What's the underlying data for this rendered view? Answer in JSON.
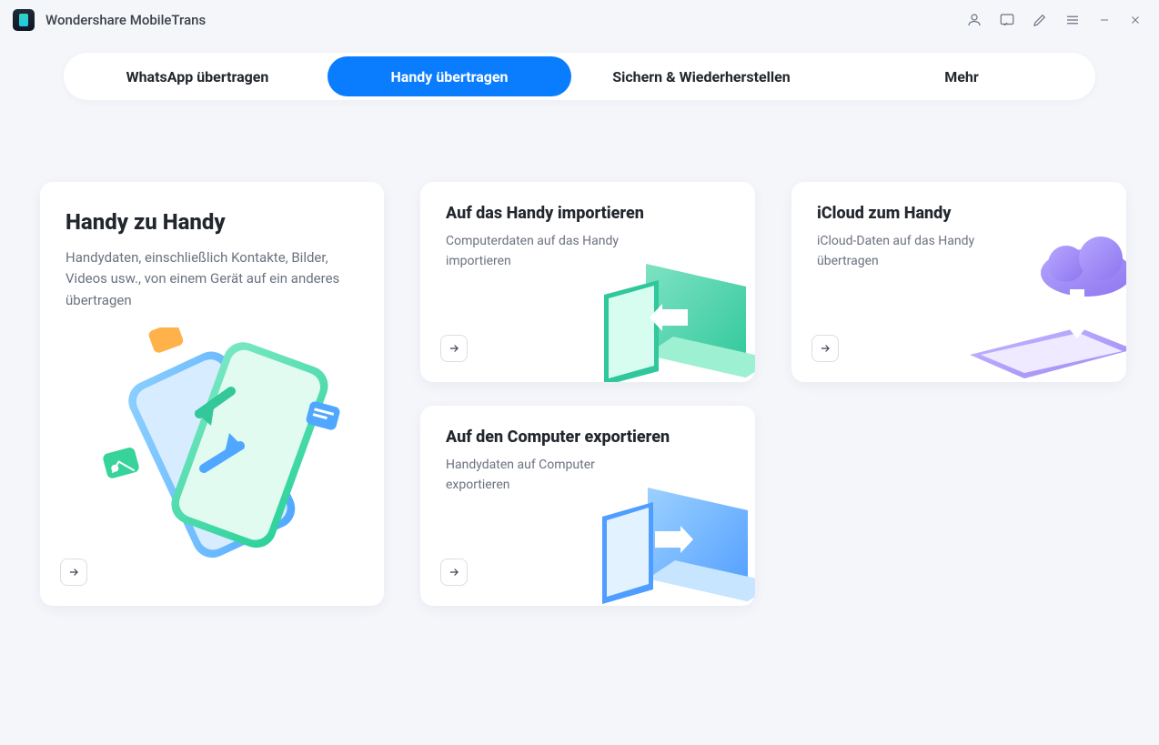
{
  "header": {
    "title": "Wondershare MobileTrans"
  },
  "tabs": [
    {
      "label": "WhatsApp übertragen",
      "active": false
    },
    {
      "label": "Handy übertragen",
      "active": true
    },
    {
      "label": "Sichern & Wiederherstellen",
      "active": false
    },
    {
      "label": "Mehr",
      "active": false
    }
  ],
  "cards": {
    "big": {
      "title": "Handy zu Handy",
      "desc": "Handydaten, einschließlich Kontakte, Bilder, Videos usw., von einem Gerät auf ein anderes übertragen"
    },
    "import": {
      "title": "Auf das Handy importieren",
      "desc": "Computerdaten auf das Handy importieren"
    },
    "icloud": {
      "title": "iCloud zum Handy",
      "desc": "iCloud-Daten auf das Handy übertragen"
    },
    "export": {
      "title": "Auf den Computer exportieren",
      "desc": "Handydaten auf Computer exportieren"
    }
  }
}
